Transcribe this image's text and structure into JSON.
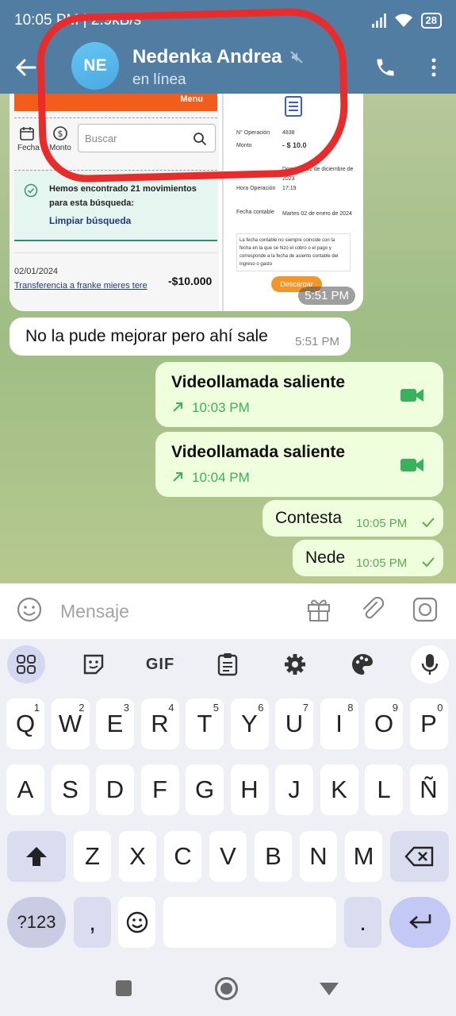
{
  "status_bar": {
    "left": "10:05 PM | 2.9kB/s",
    "battery": "28"
  },
  "header": {
    "avatar_initials": "NE",
    "name": "Nedenka Andrea",
    "status": "en línea"
  },
  "image_message": {
    "time": "5:51 PM",
    "left_screenshot": {
      "menu_label": "Menu",
      "filter_fecha": "Fecha",
      "filter_monto": "Monto",
      "search_placeholder": "Buscar",
      "found_text": "Hemos encontrado 21 movimientos para esta búsqueda:",
      "clear_search": "Limpiar búsqueda",
      "tx_date": "02/01/2024",
      "tx_desc": "Transferencia a franke mieres tere",
      "tx_amount": "-$10.000"
    },
    "right_screenshot": {
      "op_label": "N° Operación",
      "op_value": "4838",
      "monto_label": "Monto",
      "monto_value": "- $ 10.0",
      "fecha_value": "Domingo 31 de diciembre de 2023",
      "hora_label": "Hora Operación",
      "hora_value": "17:19",
      "fc_label": "Fecha contable",
      "fc_value": "Martes 02 de enero de 2024",
      "note": "La fecha contable no siempre coincide con la fecha en la que se hizo el cobro o el pago y corresponde a la fecha de asiento contable del ingreso o gasto",
      "download": "Descargar"
    }
  },
  "messages": [
    {
      "text": "No la pude mejorar pero ahí sale",
      "time": "5:51 PM"
    },
    {
      "title": "Videollamada saliente",
      "time": "10:03 PM"
    },
    {
      "title": "Videollamada saliente",
      "time": "10:04 PM"
    },
    {
      "text": "Contesta",
      "time": "10:05 PM"
    },
    {
      "text": "Nede",
      "time": "10:05 PM"
    }
  ],
  "input": {
    "placeholder": "Mensaje"
  },
  "keyboard": {
    "gif_label": "GIF",
    "row1": [
      {
        "k": "Q",
        "n": "1"
      },
      {
        "k": "W",
        "n": "2"
      },
      {
        "k": "E",
        "n": "3"
      },
      {
        "k": "R",
        "n": "4"
      },
      {
        "k": "T",
        "n": "5"
      },
      {
        "k": "Y",
        "n": "6"
      },
      {
        "k": "U",
        "n": "7"
      },
      {
        "k": "I",
        "n": "8"
      },
      {
        "k": "O",
        "n": "9"
      },
      {
        "k": "P",
        "n": "0"
      }
    ],
    "row2": [
      "A",
      "S",
      "D",
      "F",
      "G",
      "H",
      "J",
      "K",
      "L",
      "Ñ"
    ],
    "row3": [
      "Z",
      "X",
      "C",
      "V",
      "B",
      "N",
      "M"
    ],
    "sym_label": "?123",
    "comma": ",",
    "period": "."
  },
  "colors": {
    "header": "#527da3",
    "annotation": "#ea2b2b",
    "outgoing_bubble": "#effedd",
    "call_green": "#3ab15c"
  }
}
